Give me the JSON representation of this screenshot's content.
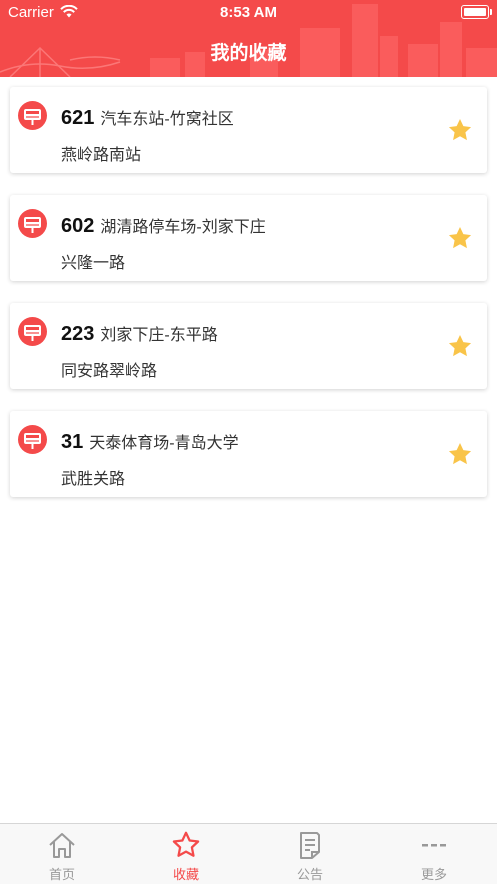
{
  "status_bar": {
    "carrier": "Carrier",
    "time": "8:53 AM",
    "wifi_icon": "wifi-icon",
    "battery_icon": "battery-icon"
  },
  "header": {
    "title": "我的收藏",
    "background_color": "#f44a4a"
  },
  "favorites": [
    {
      "route": "621",
      "name": "汽车东站-竹窝社区",
      "stop": "燕岭路南站",
      "icon": "bus-stop-icon",
      "favorited": true
    },
    {
      "route": "602",
      "name": "湖清路停车场-刘家下庄",
      "stop": "兴隆一路",
      "icon": "bus-stop-icon",
      "favorited": true
    },
    {
      "route": "223",
      "name": "刘家下庄-东平路",
      "stop": "同安路翠岭路",
      "icon": "bus-stop-icon",
      "favorited": true
    },
    {
      "route": "31",
      "name": "天泰体育场-青岛大学",
      "stop": "武胜关路",
      "icon": "bus-stop-icon",
      "favorited": true
    }
  ],
  "tabs": [
    {
      "label": "首页",
      "icon": "home-icon",
      "active": false
    },
    {
      "label": "收藏",
      "icon": "star-icon",
      "active": true
    },
    {
      "label": "公告",
      "icon": "notice-icon",
      "active": false
    },
    {
      "label": "更多",
      "icon": "more-icon",
      "active": false
    }
  ],
  "colors": {
    "accent": "#f44a4a",
    "star": "#f9c449",
    "tab_inactive": "#999999"
  }
}
